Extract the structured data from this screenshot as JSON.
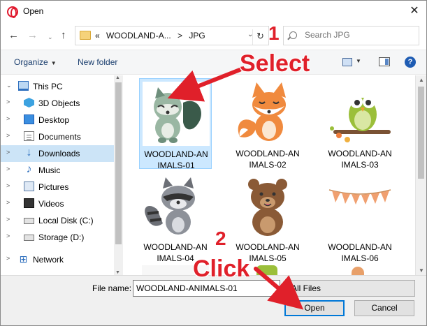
{
  "window": {
    "title": "Open",
    "close_label": "✕"
  },
  "address": {
    "crumbs": [
      "«",
      "WOODLAND-A...",
      ">",
      "JPG"
    ],
    "dropdown": "⌄",
    "refresh": "↻",
    "search_placeholder": "Search JPG"
  },
  "nav_buttons": {
    "back": "←",
    "forward": "→",
    "recent": "⌄",
    "up": "↑"
  },
  "toolbar": {
    "organize": "Organize",
    "organize_caret": "▼",
    "new_folder": "New folder",
    "view_caret": "▼",
    "help": "?"
  },
  "nav": {
    "items": [
      {
        "label": "This PC",
        "icon": "computer-icon",
        "chevron": "⌄",
        "selected": false
      },
      {
        "label": "3D Objects",
        "icon": "3d-objects-icon",
        "chevron": ">",
        "selected": false
      },
      {
        "label": "Desktop",
        "icon": "desktop-icon",
        "chevron": ">",
        "selected": false
      },
      {
        "label": "Documents",
        "icon": "documents-icon",
        "chevron": ">",
        "selected": false
      },
      {
        "label": "Downloads",
        "icon": "downloads-icon",
        "chevron": ">",
        "selected": true
      },
      {
        "label": "Music",
        "icon": "music-icon",
        "chevron": ">",
        "selected": false
      },
      {
        "label": "Pictures",
        "icon": "pictures-icon",
        "chevron": ">",
        "selected": false
      },
      {
        "label": "Videos",
        "icon": "videos-icon",
        "chevron": ">",
        "selected": false
      },
      {
        "label": "Local Disk (C:)",
        "icon": "local-disk-icon",
        "chevron": ">",
        "selected": false
      },
      {
        "label": "Storage (D:)",
        "icon": "storage-disk-icon",
        "chevron": ">",
        "selected": false
      },
      {
        "label": "Network",
        "icon": "network-icon",
        "chevron": ">",
        "selected": false
      }
    ]
  },
  "files": [
    {
      "name_line1": "WOODLAND-AN",
      "name_line2": "IMALS-01",
      "thumbnail": "raccoon-squirrel-thumbnail",
      "selected": true
    },
    {
      "name_line1": "WOODLAND-AN",
      "name_line2": "IMALS-02",
      "thumbnail": "fox-thumbnail",
      "selected": false
    },
    {
      "name_line1": "WOODLAND-AN",
      "name_line2": "IMALS-03",
      "thumbnail": "owl-thumbnail",
      "selected": false
    },
    {
      "name_line1": "WOODLAND-AN",
      "name_line2": "IMALS-04",
      "thumbnail": "raccoon-thumbnail",
      "selected": false
    },
    {
      "name_line1": "WOODLAND-AN",
      "name_line2": "IMALS-05",
      "thumbnail": "bear-thumbnail",
      "selected": false
    },
    {
      "name_line1": "WOODLAND-AN",
      "name_line2": "IMALS-06",
      "thumbnail": "bunting-thumbnail",
      "selected": false
    }
  ],
  "bottom": {
    "file_name_label": "File name:",
    "file_name_value": "WOODLAND-ANIMALS-01",
    "filter_value": "All Files",
    "filter_caret": "⌄",
    "open_label": "Open",
    "cancel_label": "Cancel"
  },
  "annotations": {
    "step1": "1",
    "select": "Select",
    "step2": "2",
    "click": "Click",
    "color": "#e0202a"
  }
}
